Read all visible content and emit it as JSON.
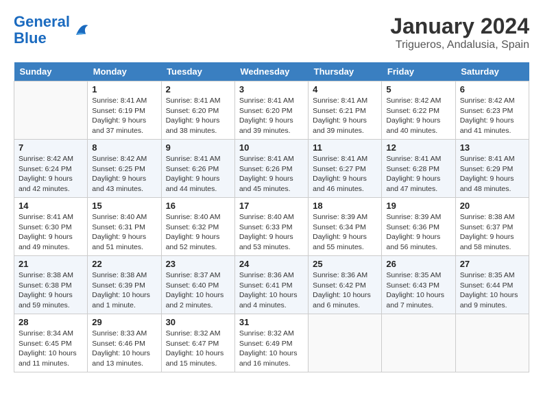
{
  "logo": {
    "line1": "General",
    "line2": "Blue"
  },
  "title": "January 2024",
  "subtitle": "Trigueros, Andalusia, Spain",
  "days_of_week": [
    "Sunday",
    "Monday",
    "Tuesday",
    "Wednesday",
    "Thursday",
    "Friday",
    "Saturday"
  ],
  "weeks": [
    [
      {
        "day": "",
        "info": ""
      },
      {
        "day": "1",
        "info": "Sunrise: 8:41 AM\nSunset: 6:19 PM\nDaylight: 9 hours\nand 37 minutes."
      },
      {
        "day": "2",
        "info": "Sunrise: 8:41 AM\nSunset: 6:20 PM\nDaylight: 9 hours\nand 38 minutes."
      },
      {
        "day": "3",
        "info": "Sunrise: 8:41 AM\nSunset: 6:20 PM\nDaylight: 9 hours\nand 39 minutes."
      },
      {
        "day": "4",
        "info": "Sunrise: 8:41 AM\nSunset: 6:21 PM\nDaylight: 9 hours\nand 39 minutes."
      },
      {
        "day": "5",
        "info": "Sunrise: 8:42 AM\nSunset: 6:22 PM\nDaylight: 9 hours\nand 40 minutes."
      },
      {
        "day": "6",
        "info": "Sunrise: 8:42 AM\nSunset: 6:23 PM\nDaylight: 9 hours\nand 41 minutes."
      }
    ],
    [
      {
        "day": "7",
        "info": "Sunrise: 8:42 AM\nSunset: 6:24 PM\nDaylight: 9 hours\nand 42 minutes."
      },
      {
        "day": "8",
        "info": "Sunrise: 8:42 AM\nSunset: 6:25 PM\nDaylight: 9 hours\nand 43 minutes."
      },
      {
        "day": "9",
        "info": "Sunrise: 8:41 AM\nSunset: 6:26 PM\nDaylight: 9 hours\nand 44 minutes."
      },
      {
        "day": "10",
        "info": "Sunrise: 8:41 AM\nSunset: 6:26 PM\nDaylight: 9 hours\nand 45 minutes."
      },
      {
        "day": "11",
        "info": "Sunrise: 8:41 AM\nSunset: 6:27 PM\nDaylight: 9 hours\nand 46 minutes."
      },
      {
        "day": "12",
        "info": "Sunrise: 8:41 AM\nSunset: 6:28 PM\nDaylight: 9 hours\nand 47 minutes."
      },
      {
        "day": "13",
        "info": "Sunrise: 8:41 AM\nSunset: 6:29 PM\nDaylight: 9 hours\nand 48 minutes."
      }
    ],
    [
      {
        "day": "14",
        "info": "Sunrise: 8:41 AM\nSunset: 6:30 PM\nDaylight: 9 hours\nand 49 minutes."
      },
      {
        "day": "15",
        "info": "Sunrise: 8:40 AM\nSunset: 6:31 PM\nDaylight: 9 hours\nand 51 minutes."
      },
      {
        "day": "16",
        "info": "Sunrise: 8:40 AM\nSunset: 6:32 PM\nDaylight: 9 hours\nand 52 minutes."
      },
      {
        "day": "17",
        "info": "Sunrise: 8:40 AM\nSunset: 6:33 PM\nDaylight: 9 hours\nand 53 minutes."
      },
      {
        "day": "18",
        "info": "Sunrise: 8:39 AM\nSunset: 6:34 PM\nDaylight: 9 hours\nand 55 minutes."
      },
      {
        "day": "19",
        "info": "Sunrise: 8:39 AM\nSunset: 6:36 PM\nDaylight: 9 hours\nand 56 minutes."
      },
      {
        "day": "20",
        "info": "Sunrise: 8:38 AM\nSunset: 6:37 PM\nDaylight: 9 hours\nand 58 minutes."
      }
    ],
    [
      {
        "day": "21",
        "info": "Sunrise: 8:38 AM\nSunset: 6:38 PM\nDaylight: 9 hours\nand 59 minutes."
      },
      {
        "day": "22",
        "info": "Sunrise: 8:38 AM\nSunset: 6:39 PM\nDaylight: 10 hours\nand 1 minute."
      },
      {
        "day": "23",
        "info": "Sunrise: 8:37 AM\nSunset: 6:40 PM\nDaylight: 10 hours\nand 2 minutes."
      },
      {
        "day": "24",
        "info": "Sunrise: 8:36 AM\nSunset: 6:41 PM\nDaylight: 10 hours\nand 4 minutes."
      },
      {
        "day": "25",
        "info": "Sunrise: 8:36 AM\nSunset: 6:42 PM\nDaylight: 10 hours\nand 6 minutes."
      },
      {
        "day": "26",
        "info": "Sunrise: 8:35 AM\nSunset: 6:43 PM\nDaylight: 10 hours\nand 7 minutes."
      },
      {
        "day": "27",
        "info": "Sunrise: 8:35 AM\nSunset: 6:44 PM\nDaylight: 10 hours\nand 9 minutes."
      }
    ],
    [
      {
        "day": "28",
        "info": "Sunrise: 8:34 AM\nSunset: 6:45 PM\nDaylight: 10 hours\nand 11 minutes."
      },
      {
        "day": "29",
        "info": "Sunrise: 8:33 AM\nSunset: 6:46 PM\nDaylight: 10 hours\nand 13 minutes."
      },
      {
        "day": "30",
        "info": "Sunrise: 8:32 AM\nSunset: 6:47 PM\nDaylight: 10 hours\nand 15 minutes."
      },
      {
        "day": "31",
        "info": "Sunrise: 8:32 AM\nSunset: 6:49 PM\nDaylight: 10 hours\nand 16 minutes."
      },
      {
        "day": "",
        "info": ""
      },
      {
        "day": "",
        "info": ""
      },
      {
        "day": "",
        "info": ""
      }
    ]
  ]
}
